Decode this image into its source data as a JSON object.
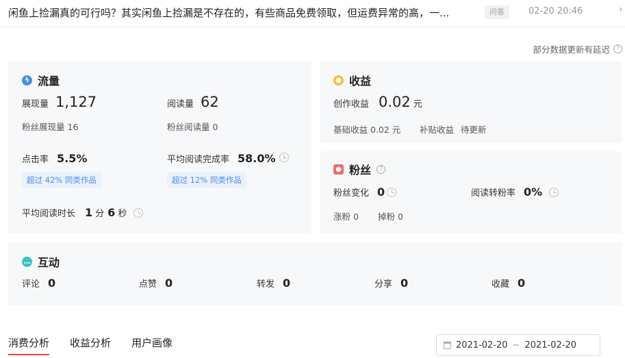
{
  "header": {
    "title": "闲鱼上捡漏真的可行吗？其实闲鱼上捡漏是不存在的，有些商品免费领取，但运费异常的高，一...",
    "badge": "问答",
    "time": "02-20 20:46",
    "more": "›"
  },
  "notice": {
    "text": "部分数据更新有延迟"
  },
  "traffic": {
    "title": "流量",
    "impressions": {
      "label": "展现量",
      "value": "1,127"
    },
    "reads": {
      "label": "阅读量",
      "value": "62"
    },
    "fan_impressions": {
      "label": "粉丝展现量",
      "value": "16"
    },
    "fan_reads": {
      "label": "粉丝阅读量",
      "value": "0"
    },
    "ctr": {
      "label": "点击率",
      "value": "5.5%",
      "badge": "超过 42% 同类作品"
    },
    "completion": {
      "label": "平均阅读完成率",
      "value": "58.0%",
      "badge": "超过 12% 同类作品"
    },
    "duration": {
      "label": "平均阅读时长",
      "minutes": "1",
      "minute_unit": "分",
      "seconds": "6",
      "second_unit": "秒"
    }
  },
  "income": {
    "title": "收益",
    "creation": {
      "label": "创作收益",
      "value": "0.02",
      "unit": "元"
    },
    "base": {
      "label": "基础收益",
      "value": "0.02 元"
    },
    "subsidy": {
      "label": "补贴收益",
      "value": "待更新"
    }
  },
  "fans": {
    "title": "粉丝",
    "change": {
      "label": "粉丝变化",
      "value": "0"
    },
    "conversion": {
      "label": "阅读转粉率",
      "value": "0%"
    },
    "gained": {
      "label": "涨粉",
      "value": "0"
    },
    "lost": {
      "label": "掉粉",
      "value": "0"
    }
  },
  "interaction": {
    "title": "互动",
    "items": [
      {
        "label": "评论",
        "value": "0"
      },
      {
        "label": "点赞",
        "value": "0"
      },
      {
        "label": "转发",
        "value": "0"
      },
      {
        "label": "分享",
        "value": "0"
      },
      {
        "label": "收藏",
        "value": "0"
      }
    ]
  },
  "tabs": [
    {
      "label": "消费分析",
      "active": true
    },
    {
      "label": "收益分析",
      "active": false
    },
    {
      "label": "用户画像",
      "active": false
    }
  ],
  "date_range": {
    "start": "2021-02-20",
    "separator": "~",
    "end": "2021-02-20"
  },
  "colors": {
    "traffic_icon": "#4a8ee8",
    "income_icon": "#f5c033",
    "fans_icon": "#ee6b6b",
    "interaction_icon": "#3cc3c3",
    "badge_text": "#4a8ee8",
    "badge_bg": "#e9f1fd",
    "tab_underline": "#e8453c",
    "card_bg": "#f7f8fa"
  }
}
